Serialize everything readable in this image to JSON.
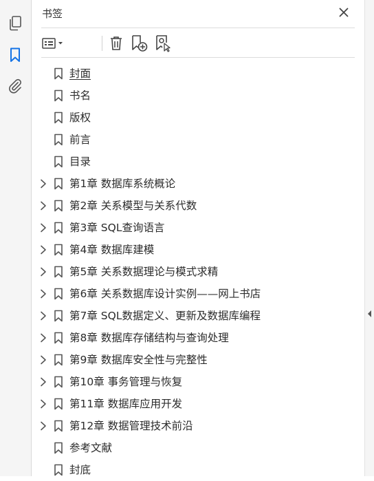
{
  "panel": {
    "title": "书签"
  },
  "rail": {
    "icons": [
      "pages-icon",
      "bookmark-icon",
      "attachment-icon"
    ]
  },
  "toolbar": {
    "icons": [
      "options-menu-icon",
      "delete-icon",
      "new-bookmark-icon",
      "bookmark-from-selection-icon"
    ]
  },
  "bookmarks": [
    {
      "label": "封面",
      "expandable": false,
      "selected": true
    },
    {
      "label": "书名",
      "expandable": false
    },
    {
      "label": "版权",
      "expandable": false
    },
    {
      "label": "前言",
      "expandable": false
    },
    {
      "label": "目录",
      "expandable": false
    },
    {
      "label": "第1章  数据库系统概论",
      "expandable": true
    },
    {
      "label": "第2章  关系模型与关系代数",
      "expandable": true
    },
    {
      "label": "第3章  SQL查询语言",
      "expandable": true
    },
    {
      "label": "第4章  数据库建模",
      "expandable": true
    },
    {
      "label": "第5章  关系数据理论与模式求精",
      "expandable": true
    },
    {
      "label": "第6章  关系数据库设计实例——网上书店",
      "expandable": true
    },
    {
      "label": "第7章  SQL数据定义、更新及数据库编程",
      "expandable": true
    },
    {
      "label": "第8章  数据库存储结构与查询处理",
      "expandable": true
    },
    {
      "label": "第9章  数据库安全性与完整性",
      "expandable": true
    },
    {
      "label": "第10章  事务管理与恢复",
      "expandable": true
    },
    {
      "label": "第11章  数据库应用开发",
      "expandable": true
    },
    {
      "label": "第12章  数据管理技术前沿",
      "expandable": true
    },
    {
      "label": "参考文献",
      "expandable": false
    },
    {
      "label": "封底",
      "expandable": false
    }
  ]
}
